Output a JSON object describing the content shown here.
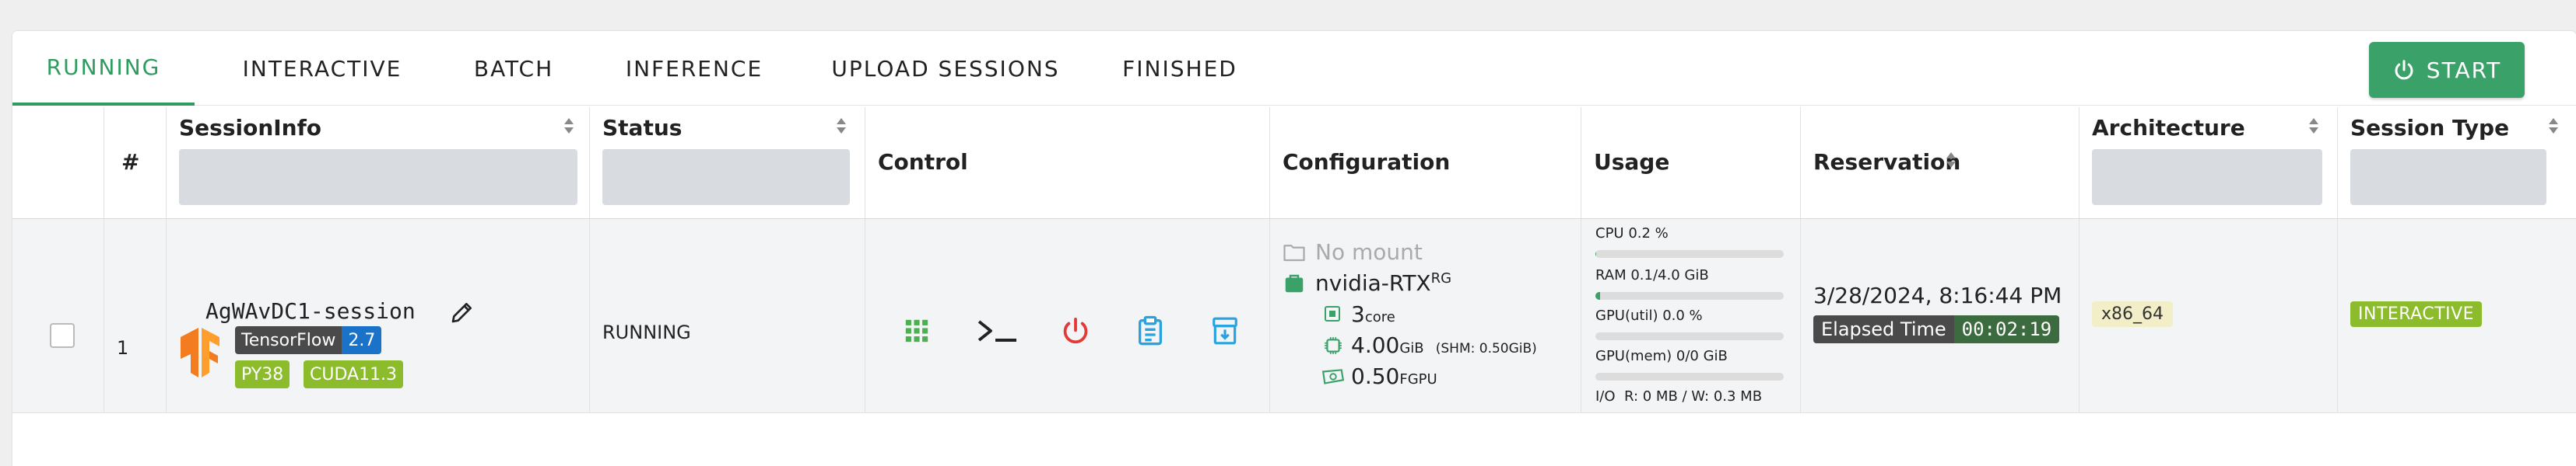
{
  "tabs": [
    {
      "label": "RUNNING",
      "active": true
    },
    {
      "label": "INTERACTIVE",
      "active": false
    },
    {
      "label": "BATCH",
      "active": false
    },
    {
      "label": "INFERENCE",
      "active": false
    },
    {
      "label": "UPLOAD SESSIONS",
      "active": false
    },
    {
      "label": "FINISHED",
      "active": false
    }
  ],
  "start_button": {
    "label": "START",
    "icon": "power-icon"
  },
  "columns": {
    "num": "#",
    "session_info": "SessionInfo",
    "status": "Status",
    "control": "Control",
    "configuration": "Configuration",
    "usage": "Usage",
    "reservation": "Reservation",
    "architecture": "Architecture",
    "session_type": "Session Type"
  },
  "row": {
    "num": "1",
    "session_name": "AgWAvDC1-session",
    "kernel_badge": {
      "name": "TensorFlow",
      "version": "2.7"
    },
    "tags": [
      "PY38",
      "CUDA11.3"
    ],
    "status": "RUNNING",
    "controls": [
      "apps-icon",
      "terminal-icon",
      "power-icon",
      "log-icon",
      "download-icon"
    ],
    "config": {
      "mount": "No mount",
      "resource_group": "nvidia-RTX",
      "resource_group_suffix": "RG",
      "cpu": "3",
      "cpu_unit": "core",
      "mem": "4.00",
      "mem_unit": "GiB",
      "shm": "(SHM: 0.50GiB)",
      "gpu": "0.50",
      "gpu_unit": "FGPU"
    },
    "usage": {
      "cpu_label": "CPU 0.2 %",
      "cpu_value": 0.002,
      "ram_label": "RAM 0.1/4.0 GiB",
      "ram_value": 0.025,
      "gpu_util_label": "GPU(util) 0.0 %",
      "gpu_util_value": 0,
      "gpu_mem_label": "GPU(mem) 0/0 GiB",
      "gpu_mem_value": 0,
      "io_label": "I/O",
      "io_value": "R: 0 MB / W: 0.3 MB"
    },
    "reservation": {
      "date": "3/28/2024, 8:16:44 PM",
      "elapsed_label": "Elapsed Time",
      "elapsed_value": "00:02:19"
    },
    "architecture": "x86_64",
    "session_type": "INTERACTIVE"
  },
  "colors": {
    "accent": "#2e9c5e",
    "start_button": "#3aa169",
    "tag_green": "#8cbc2b",
    "tf_blue": "#1a73c8",
    "power_red": "#e53935",
    "icon_blue": "#29a3e0",
    "apps_green": "#4caf50"
  }
}
